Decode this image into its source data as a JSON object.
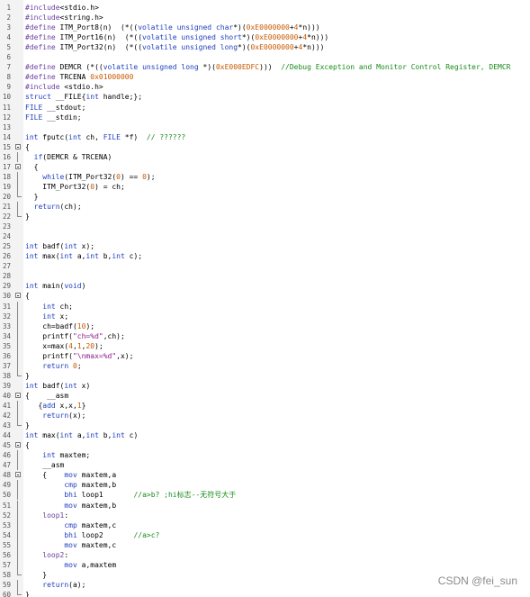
{
  "editor": {
    "lines": [
      "#include<stdio.h>",
      "#include<string.h>",
      "#define ITM_Port8(n)  (*((volatile unsigned char*)(0xE0000000+4*n)))",
      "#define ITM_Port16(n)  (*((volatile unsigned short*)(0xE0000000+4*n)))",
      "#define ITM_Port32(n)  (*((volatile unsigned long*)(0xE0000000+4*n)))",
      "",
      "#define DEMCR (*((volatile unsigned long *)(0xE000EDFC)))  //Debug Exception and Monitor Control Register, DEMCR",
      "#define TRCENA 0x01000000",
      "#include <stdio.h>",
      "struct __FILE{int handle;};",
      "FILE __stdout;",
      "FILE __stdin;",
      "",
      "int fputc(int ch, FILE *f)  // ??????",
      "{",
      "  if(DEMCR & TRCENA)",
      "  {",
      "    while(ITM_Port32(0) == 0);",
      "    ITM_Port32(0) = ch;",
      "  }",
      "  return(ch);",
      "}",
      "",
      "",
      "int badf(int x);",
      "int max(int a,int b,int c);",
      "",
      "",
      "int main(void)",
      "{",
      "    int ch;",
      "    int x;",
      "    ch=badf(10);",
      "    printf(\"ch=%d\",ch);",
      "    x=max(4,1,20);",
      "    printf(\"\\nmax=%d\",x);",
      "    return 0;",
      "}",
      "int badf(int x)",
      "{    __asm",
      "   {add x,x,1}",
      "    return(x);",
      "}",
      "int max(int a,int b,int c)",
      "{",
      "    int maxtem;",
      "    __asm",
      "    {    mov maxtem,a",
      "         cmp maxtem,b",
      "         bhi loop1       //a>b? ;hi标志--无符号大于",
      "         mov maxtem,b",
      "    loop1:",
      "         cmp maxtem,c",
      "         bhi loop2       //a>c?",
      "         mov maxtem,c",
      "    loop2:",
      "         mov a,maxtem",
      "    }",
      "    return(a);",
      "}"
    ]
  },
  "watermark": "CSDN @fei_sun",
  "colors": {
    "keyword": "#1f3fbf",
    "preproc": "#6b3fa0",
    "comment": "#1a8a1a",
    "string": "#8a1a8a",
    "number": "#c85a00",
    "gutter": "#f3f3f3"
  }
}
